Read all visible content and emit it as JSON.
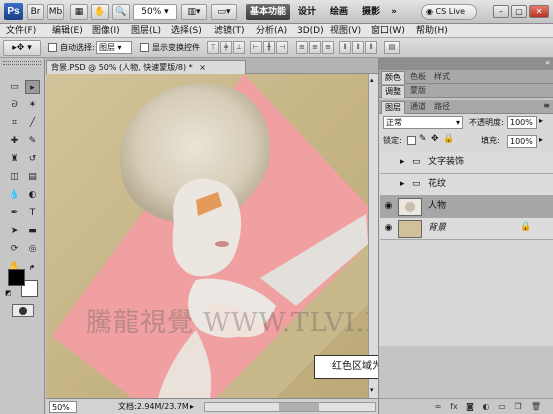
{
  "titlebar": {
    "logo": "Ps",
    "zoom": "50%",
    "workspaces": [
      "基本功能",
      "设计",
      "绘画",
      "摄影"
    ],
    "more": "»",
    "cslive": "CS Live"
  },
  "menu": [
    "文件(F)",
    "编辑(E)",
    "图像(I)",
    "图层(L)",
    "选择(S)",
    "滤镜(T)",
    "分析(A)",
    "3D(D)",
    "视图(V)",
    "窗口(W)",
    "帮助(H)"
  ],
  "options": {
    "auto_select_label": "自动选择:",
    "auto_select_value": "图层",
    "show_transform_label": "显示变换控件"
  },
  "document": {
    "tab_title": "背景.PSD @ 50% (人物, 快速蒙版/8) *"
  },
  "canvas": {
    "watermark": "騰龍視覺 WWW.TLVI.NET",
    "callout": "红色区域为非选择区域"
  },
  "status": {
    "zoom": "50%",
    "doc_info": "文档:2.94M/23.7M"
  },
  "panels": {
    "top_tabs": [
      "颜色",
      "色板",
      "样式"
    ],
    "adj_tabs": [
      "调整",
      "蒙版"
    ],
    "layer_tabs": [
      "图层",
      "通道",
      "路径"
    ],
    "blend_mode": "正常",
    "opacity_label": "不透明度:",
    "opacity_value": "100%",
    "lock_label": "锁定:",
    "fill_label": "填充:",
    "fill_value": "100%",
    "layers": [
      {
        "name": "文字装饰"
      },
      {
        "name": "花纹"
      },
      {
        "name": "人物"
      },
      {
        "name": "背景"
      }
    ]
  },
  "colors": {
    "quick_mask": "#f0a0a0",
    "paper": "#c9b88b"
  }
}
